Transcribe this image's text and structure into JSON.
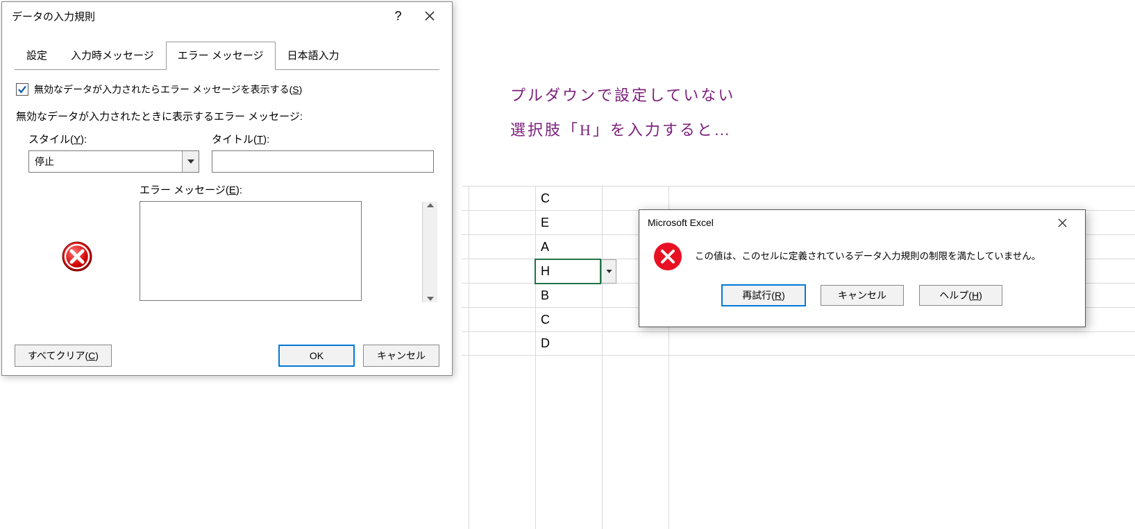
{
  "dv": {
    "title": "データの入力規則",
    "tabs": [
      "設定",
      "入力時メッセージ",
      "エラー メッセージ",
      "日本語入力"
    ],
    "active_tab": 2,
    "show_error_checkbox_label": "無効なデータが入力されたらエラー メッセージを表示する(",
    "show_error_checkbox_key": "S",
    "show_error_checkbox_suffix": ")",
    "section_label": "無効なデータが入力されたときに表示するエラー メッセージ:",
    "style_label": "スタイル(",
    "style_key": "Y",
    "style_suffix": "):",
    "style_value": "停止",
    "title_label": "タイトル(",
    "title_key": "T",
    "title_suffix": "):",
    "title_value": "",
    "errmsg_label": "エラー メッセージ(",
    "errmsg_key": "E",
    "errmsg_suffix": "):",
    "errmsg_value": "",
    "clear_all": "すべてクリア(",
    "clear_all_key": "C",
    "clear_all_suffix": ")",
    "ok": "OK",
    "cancel": "キャンセル"
  },
  "annotation": {
    "line1": "プルダウンで設定していない",
    "line2": "選択肢「H」を入力すると…"
  },
  "column_values": [
    "C",
    "E",
    "A",
    "H",
    "B",
    "C",
    "D"
  ],
  "active_cell_value": "H",
  "err": {
    "title": "Microsoft Excel",
    "message": "この値は、このセルに定義されているデータ入力規則の制限を満たしていません。",
    "retry": "再試行(",
    "retry_key": "R",
    "retry_suffix": ")",
    "cancel": "キャンセル",
    "help": "ヘルプ(",
    "help_key": "H",
    "help_suffix": ")"
  },
  "icons": {
    "stop": "stop-icon",
    "close": "close-icon",
    "help": "help-icon",
    "dropdown": "chevron-down-icon",
    "error_circle": "error-circle-icon"
  }
}
